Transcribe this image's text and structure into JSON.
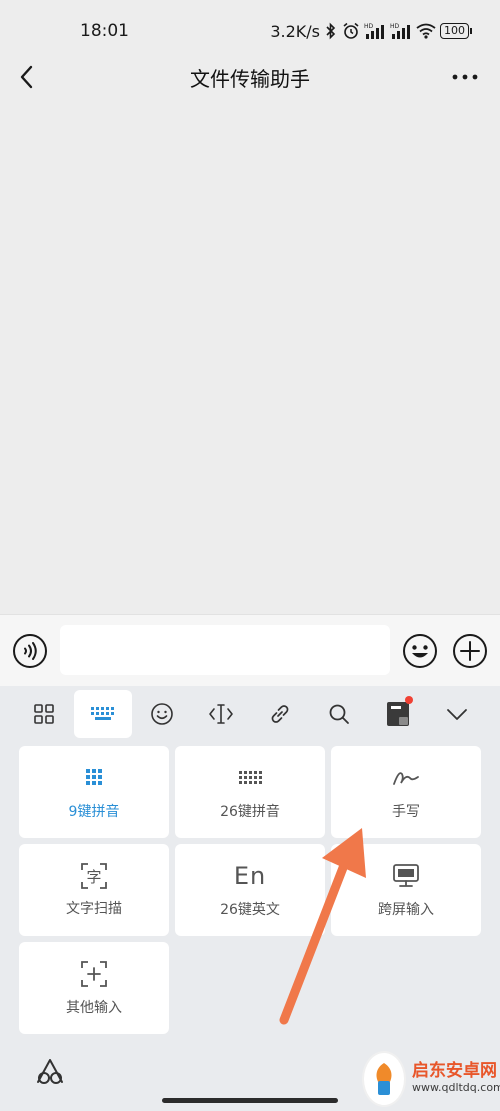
{
  "status_bar": {
    "time": "18:01",
    "net_speed": "3.2K/s",
    "battery": "100",
    "icons": [
      "bluetooth-icon",
      "alarm-icon",
      "signal-hd-icon",
      "signal-hd-icon",
      "wifi-icon",
      "battery-icon"
    ]
  },
  "header": {
    "title": "文件传输助手",
    "back_icon": "chevron-left-icon",
    "more_icon": "more-dots-icon"
  },
  "input_bar": {
    "voice_icon": "voice-icon",
    "message_value": "",
    "emoji_icon": "emoji-icon",
    "plus_icon": "plus-circle-icon"
  },
  "keyboard": {
    "toolbar": [
      {
        "icon": "grid-icon"
      },
      {
        "icon": "keyboard-icon",
        "active": true
      },
      {
        "icon": "emoji-icon"
      },
      {
        "icon": "cursor-icon"
      },
      {
        "icon": "link-icon"
      },
      {
        "icon": "search-icon"
      },
      {
        "icon": "book-icon",
        "badge": true
      },
      {
        "icon": "chevron-down-icon"
      }
    ],
    "modes": [
      {
        "label": "9键拼音",
        "icon": "nine-key-icon",
        "active": true
      },
      {
        "label": "26键拼音",
        "icon": "twenty-six-key-icon"
      },
      {
        "label": "手写",
        "icon": "handwriting-icon"
      },
      {
        "label": "文字扫描",
        "icon": "text-scan-icon",
        "glyph": "字"
      },
      {
        "label": "26键英文",
        "icon": "english-icon",
        "glyph": "En"
      },
      {
        "label": "跨屏输入",
        "icon": "monitor-icon"
      },
      {
        "label": "其他输入",
        "icon": "add-box-icon"
      }
    ],
    "bottom_icon": "brand-logo-icon"
  },
  "colors": {
    "accent_blue": "#2a8fd6",
    "arrow": "#f0784a",
    "badge": "#f04134"
  },
  "watermark": {
    "title": "启东安卓网",
    "url": "www.qdltdq.com"
  }
}
